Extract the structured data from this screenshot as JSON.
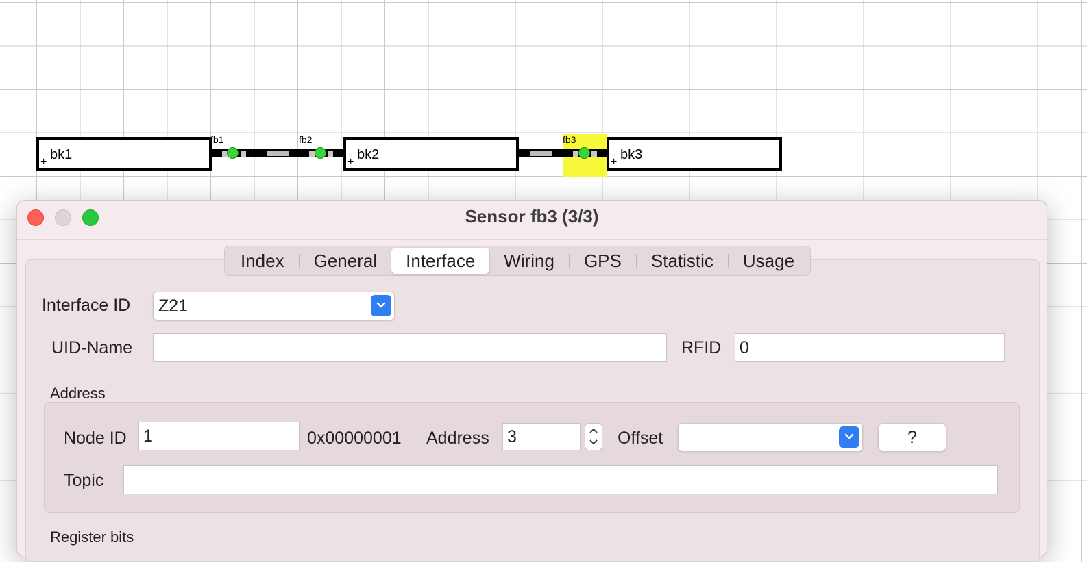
{
  "track": {
    "blocks": [
      {
        "name": "bk1",
        "marker": "+"
      },
      {
        "name": "bk2",
        "marker": "+"
      },
      {
        "name": "bk3",
        "marker": "+"
      }
    ],
    "sensors": [
      {
        "name": "fb1",
        "state": "occupied",
        "color": "#3ad43a"
      },
      {
        "name": "fb2",
        "state": "occupied",
        "color": "#3ad43a"
      },
      {
        "name": "fb3",
        "state": "selected",
        "color": "#3ad43a",
        "highlight": "#f8f83a"
      }
    ]
  },
  "dialog": {
    "title": "Sensor fb3 (3/3)",
    "tabs": [
      {
        "label": "Index"
      },
      {
        "label": "General"
      },
      {
        "label": "Interface",
        "active": true
      },
      {
        "label": "Wiring"
      },
      {
        "label": "GPS"
      },
      {
        "label": "Statistic"
      },
      {
        "label": "Usage"
      }
    ],
    "interface_id": {
      "label": "Interface ID",
      "value": "Z21"
    },
    "uid_name": {
      "label": "UID-Name",
      "value": ""
    },
    "rfid": {
      "label": "RFID",
      "value": "0"
    },
    "address_group": {
      "title": "Address",
      "node_id": {
        "label": "Node ID",
        "value": "1",
        "hex": "0x00000001"
      },
      "address": {
        "label": "Address",
        "value": "3"
      },
      "offset": {
        "label": "Offset",
        "value": ""
      },
      "help_label": "?",
      "topic": {
        "label": "Topic",
        "value": ""
      }
    },
    "next_group_title": "Register bits"
  }
}
